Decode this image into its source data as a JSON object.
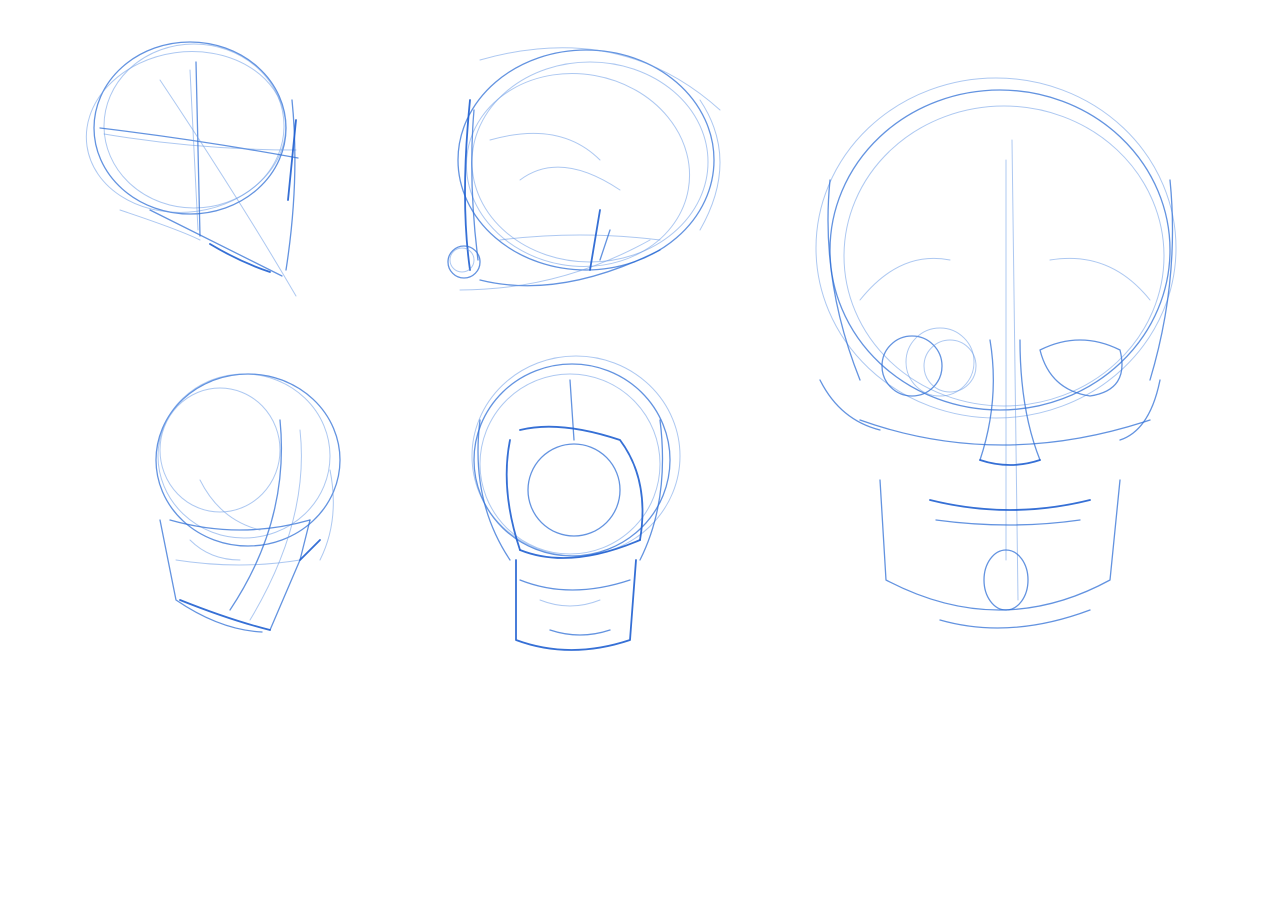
{
  "canvas": {
    "background": "#ffffff",
    "stroke_color": "#2f6fd6",
    "stroke_color_light": "#6a9be6",
    "stroke_color_dark": "#1f5fd0"
  },
  "sketches": [
    {
      "name": "skull-construction-ball-three-quarter"
    },
    {
      "name": "skull-construction-ball-side"
    },
    {
      "name": "skull-three-quarter-below"
    },
    {
      "name": "skull-back-view"
    },
    {
      "name": "skull-front-view-large"
    }
  ]
}
